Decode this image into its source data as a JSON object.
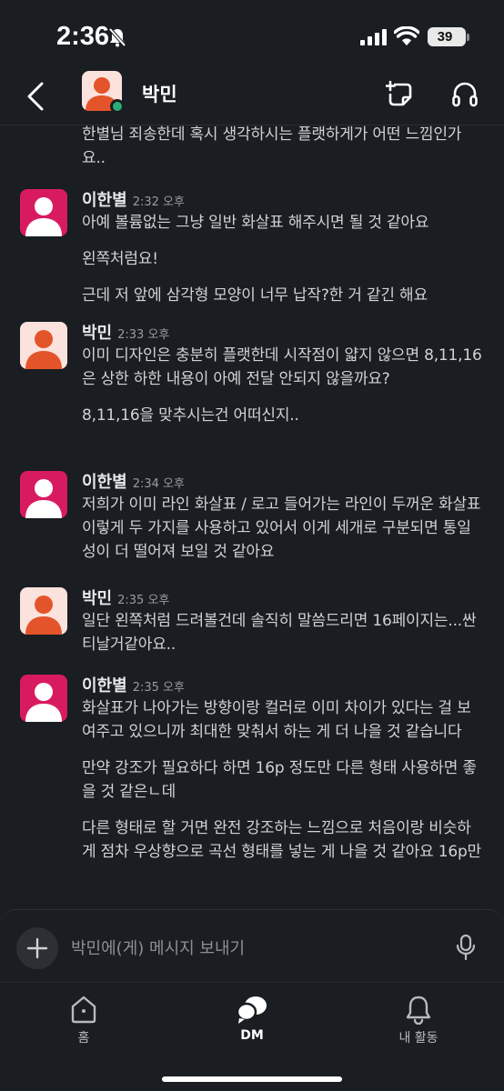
{
  "status_bar": {
    "time": "2:36",
    "battery": "39"
  },
  "header": {
    "title": "박민"
  },
  "messages": {
    "continuation_text": "한별님 죄송한데 혹시 생각하시는 플랫하게가 어떤 느낌인가요..",
    "items": [
      {
        "name": "이한별",
        "time": "2:32 오후",
        "paragraphs": [
          "아예 볼륨없는 그냥 일반 화살표 해주시면 될 것 같아요",
          "왼쪽처럼요!",
          "근데 저 앞에 삼각형 모양이 너무 납작?한 거 같긴 해요"
        ]
      },
      {
        "name": "박민",
        "time": "2:33 오후",
        "paragraphs": [
          "이미 디자인은 충분히 플랫한데 시작점이 얇지 않으면 8,11,16은 상한 하한 내용이 아예 전달 안되지 않을까요?",
          "8,11,16을 맞추시는건 어떠신지.."
        ]
      },
      {
        "name": "이한별",
        "time": "2:34 오후",
        "paragraphs": [
          "저희가 이미 라인 화살표 / 로고 들어가는 라인이 두꺼운 화살표 이렇게 두 가지를 사용하고 있어서 이게 세개로 구분되면 통일성이 더 떨어져 보일 것 같아요"
        ]
      },
      {
        "name": "박민",
        "time": "2:35 오후",
        "paragraphs": [
          "일단 왼쪽처럼 드려볼건데 솔직히 말씀드리면 16페이지는...싼티날거같아요.."
        ]
      },
      {
        "name": "이한별",
        "time": "2:35 오후",
        "paragraphs": [
          "화살표가 나아가는 방향이랑 컬러로 이미 차이가 있다는 걸 보여주고 있으니까 최대한 맞춰서 하는 게 더 나을 것 같습니다",
          "만약 강조가 필요하다 하면 16p 정도만 다른 형태 사용하면 좋을 것 같은ㄴ데",
          "다른 형태로 할 거면 완전 강조하는 느낌으로 처음이랑 비슷하게 점차 우상향으로 곡선 형태를 넣는 게 나을 것 같아요 16p만"
        ]
      }
    ]
  },
  "composer": {
    "placeholder": "박민에(게) 메시지 보내기"
  },
  "tabs": [
    {
      "label": "홈",
      "icon": "home-icon"
    },
    {
      "label": "DM",
      "icon": "dm-icon"
    },
    {
      "label": "내 활동",
      "icon": "bell-icon"
    }
  ],
  "colors": {
    "background": "#1a1d21",
    "pink_avatar": "#d81b60",
    "peach_avatar": "#fbe2dd",
    "orange_figure": "#e4542a",
    "presence": "#2bac76"
  }
}
